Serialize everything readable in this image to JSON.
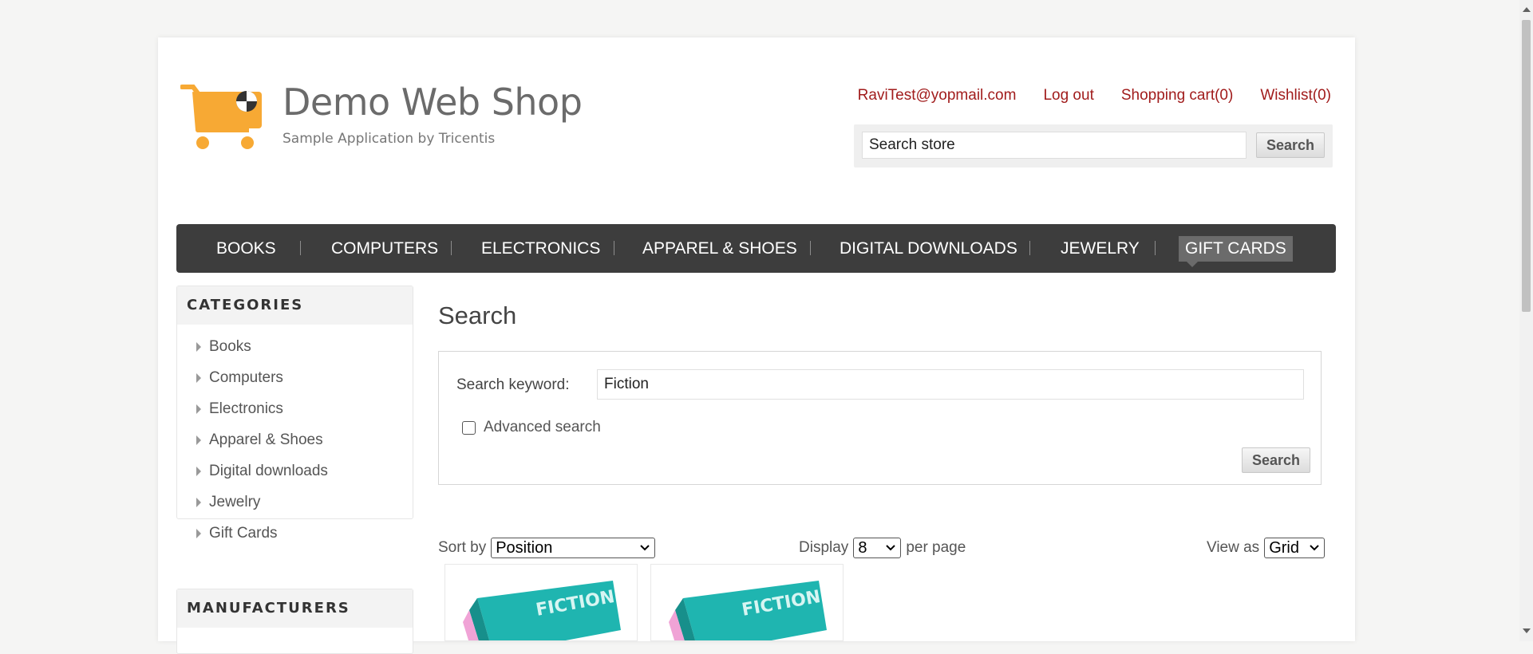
{
  "header": {
    "logo_title": "Demo Web Shop",
    "logo_subtitle": "Sample Application by Tricentis",
    "links": {
      "account": "RaviTest@yopmail.com",
      "logout": "Log out",
      "cart": "Shopping cart(0)",
      "wishlist": "Wishlist(0)"
    },
    "search": {
      "value": "Search store",
      "button": "Search"
    }
  },
  "nav": {
    "items": [
      "BOOKS",
      "COMPUTERS",
      "ELECTRONICS",
      "APPAREL & SHOES",
      "DIGITAL DOWNLOADS",
      "JEWELRY",
      "GIFT CARDS"
    ],
    "active": "GIFT CARDS"
  },
  "sidebar": {
    "categories_title": "CATEGORIES",
    "categories": [
      "Books",
      "Computers",
      "Electronics",
      "Apparel & Shoes",
      "Digital downloads",
      "Jewelry",
      "Gift Cards"
    ],
    "manufacturers_title": "MANUFACTURERS"
  },
  "main": {
    "title": "Search",
    "keyword_label": "Search keyword:",
    "keyword_value": "Fiction",
    "advanced_label": "Advanced search",
    "advanced_checked": false,
    "search_button": "Search",
    "sort_label": "Sort by",
    "sort_value": "Position",
    "display_label": "Display",
    "display_value": "8",
    "per_page_label": "per page",
    "view_label": "View as",
    "view_value": "Grid"
  },
  "products": [
    {
      "cover_text": "FICTION",
      "icon": "book-cover-image"
    },
    {
      "cover_text": "FICTION",
      "icon": "book-cover-image"
    }
  ],
  "colors": {
    "accent_link": "#a11c1c",
    "nav_bg": "#3d3d3d",
    "logo_orange": "#f7a934",
    "book_teal": "#1fb5b0"
  }
}
